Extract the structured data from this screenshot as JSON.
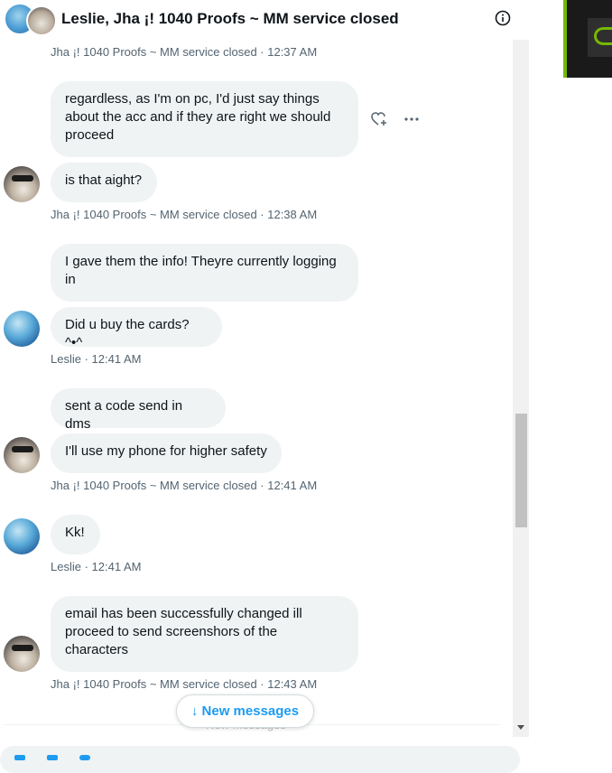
{
  "header": {
    "title": "Leslie, Jha ¡! 1040 Proofs ~ MM service closed",
    "info_icon": "info-icon"
  },
  "messages": [
    {
      "type": "meta",
      "text": "Jha ¡! 1040 Proofs ~ MM service closed · 12:37 AM"
    },
    {
      "type": "bubble",
      "sender": "Jha",
      "text": "regardless, as I'm on pc, I'd just say things about the acc and if they are right we should proceed"
    },
    {
      "type": "bubble",
      "sender": "Jha",
      "text": "is that aight?"
    },
    {
      "type": "meta",
      "text": "Jha ¡! 1040 Proofs ~ MM service closed · 12:38 AM"
    },
    {
      "type": "bubble",
      "sender": "Leslie",
      "text": "I gave them the info! Theyre currently logging in"
    },
    {
      "type": "bubble",
      "sender": "Leslie",
      "text": "Did u buy the cards? ^•^"
    },
    {
      "type": "meta",
      "text": "Leslie · 12:41 AM"
    },
    {
      "type": "bubble",
      "sender": "Jha",
      "text": "sent a code send in dms"
    },
    {
      "type": "bubble",
      "sender": "Jha",
      "text": "I'll use my phone for higher safety"
    },
    {
      "type": "meta",
      "text": "Jha ¡! 1040 Proofs ~ MM service closed · 12:41 AM"
    },
    {
      "type": "bubble",
      "sender": "Leslie",
      "text": "Kk!"
    },
    {
      "type": "meta",
      "text": "Leslie · 12:41 AM"
    },
    {
      "type": "bubble",
      "sender": "Jha",
      "text": "email has been successfully changed ill proceed to send screenshors of the characters"
    },
    {
      "type": "meta",
      "text": "Jha ¡! 1040 Proofs ~ MM service closed · 12:43 AM"
    }
  ],
  "new_messages": {
    "label": "↓ New messages",
    "faint_label": "New messages"
  }
}
